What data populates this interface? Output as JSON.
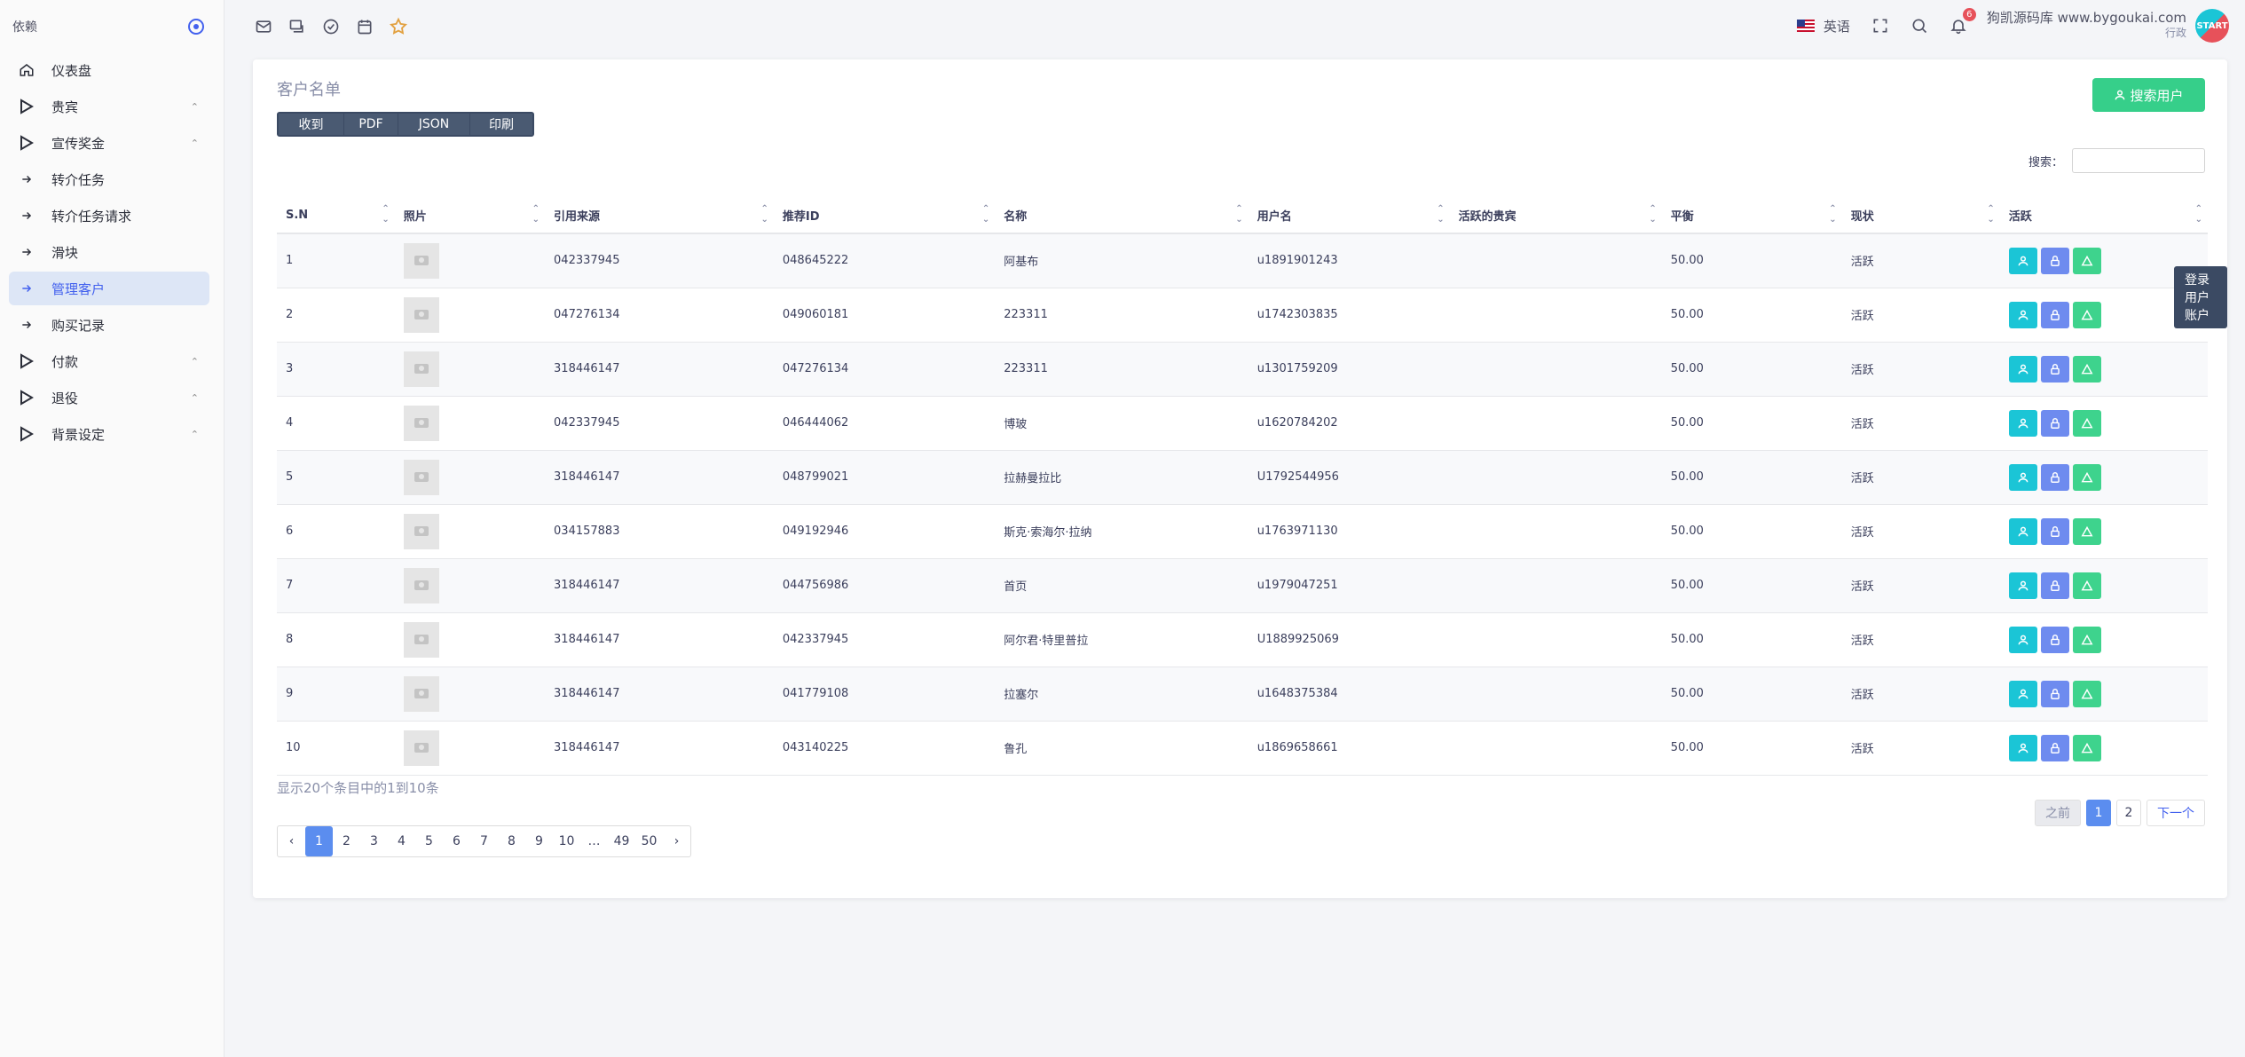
{
  "sidebar": {
    "title": "依赖",
    "items": [
      {
        "label": "仪表盘",
        "icon": "home-icon"
      },
      {
        "label": "贵宾",
        "icon": "triangle-icon",
        "chev": "⌃"
      },
      {
        "label": "宣传奖金",
        "icon": "triangle-icon",
        "chev": "⌃"
      },
      {
        "label": "转介任务",
        "icon": "arrow-icon"
      },
      {
        "label": "转介任务请求",
        "icon": "arrow-icon"
      },
      {
        "label": "滑块",
        "icon": "arrow-icon"
      },
      {
        "label": "管理客户",
        "icon": "arrow-icon",
        "active": true
      },
      {
        "label": "购买记录",
        "icon": "arrow-icon"
      },
      {
        "label": "付款",
        "icon": "triangle-icon",
        "chev": "⌃"
      },
      {
        "label": "退役",
        "icon": "triangle-icon",
        "chev": "⌃"
      },
      {
        "label": "背景设定",
        "icon": "triangle-icon",
        "chev": "⌃"
      }
    ]
  },
  "topbar": {
    "language": "英语",
    "notification_count": "6",
    "user_name": "狗凯源码库 www.bygoukai.com",
    "user_role": "行政",
    "avatar_text": "START"
  },
  "card": {
    "title": "客户名单",
    "export_buttons": [
      "收到",
      "PDF",
      "JSON",
      "印刷"
    ],
    "search_user_button": "搜索用户",
    "search_label": "搜索：",
    "search_value": "",
    "tooltip": "登录用户账户",
    "columns": [
      "S.N",
      "照片",
      "引用来源",
      "推荐ID",
      "名称",
      "用户名",
      "活跃的贵宾",
      "平衡",
      "现状",
      "活跃"
    ],
    "rows": [
      {
        "sn": "1",
        "ref": "042337945",
        "rid": "048645222",
        "name": "阿基布",
        "user": "u1891901243",
        "vip": "",
        "bal": "50.00",
        "status": "活跃"
      },
      {
        "sn": "2",
        "ref": "047276134",
        "rid": "049060181",
        "name": "223311",
        "user": "u1742303835",
        "vip": "",
        "bal": "50.00",
        "status": "活跃"
      },
      {
        "sn": "3",
        "ref": "318446147",
        "rid": "047276134",
        "name": "223311",
        "user": "u1301759209",
        "vip": "",
        "bal": "50.00",
        "status": "活跃"
      },
      {
        "sn": "4",
        "ref": "042337945",
        "rid": "046444062",
        "name": "博玻",
        "user": "u1620784202",
        "vip": "",
        "bal": "50.00",
        "status": "活跃"
      },
      {
        "sn": "5",
        "ref": "318446147",
        "rid": "048799021",
        "name": "拉赫曼拉比",
        "user": "U1792544956",
        "vip": "",
        "bal": "50.00",
        "status": "活跃"
      },
      {
        "sn": "6",
        "ref": "034157883",
        "rid": "049192946",
        "name": "斯克·索海尔·拉纳",
        "user": "u1763971130",
        "vip": "",
        "bal": "50.00",
        "status": "活跃"
      },
      {
        "sn": "7",
        "ref": "318446147",
        "rid": "044756986",
        "name": "首页",
        "user": "u1979047251",
        "vip": "",
        "bal": "50.00",
        "status": "活跃"
      },
      {
        "sn": "8",
        "ref": "318446147",
        "rid": "042337945",
        "name": "阿尔君·特里普拉",
        "user": "U1889925069",
        "vip": "",
        "bal": "50.00",
        "status": "活跃"
      },
      {
        "sn": "9",
        "ref": "318446147",
        "rid": "041779108",
        "name": "拉塞尔",
        "user": "u1648375384",
        "vip": "",
        "bal": "50.00",
        "status": "活跃"
      },
      {
        "sn": "10",
        "ref": "318446147",
        "rid": "043140225",
        "name": "鲁孔",
        "user": "u1869658661",
        "vip": "",
        "bal": "50.00",
        "status": "活跃"
      }
    ],
    "info": "显示20个条目中的1到10条",
    "pager_small": {
      "prev": "之前",
      "pages": [
        "1",
        "2"
      ],
      "next": "下一个"
    },
    "pager": {
      "prev": "‹",
      "pages": [
        "1",
        "2",
        "3",
        "4",
        "5",
        "6",
        "7",
        "8",
        "9",
        "10",
        "…",
        "49",
        "50"
      ],
      "next": "›"
    }
  }
}
